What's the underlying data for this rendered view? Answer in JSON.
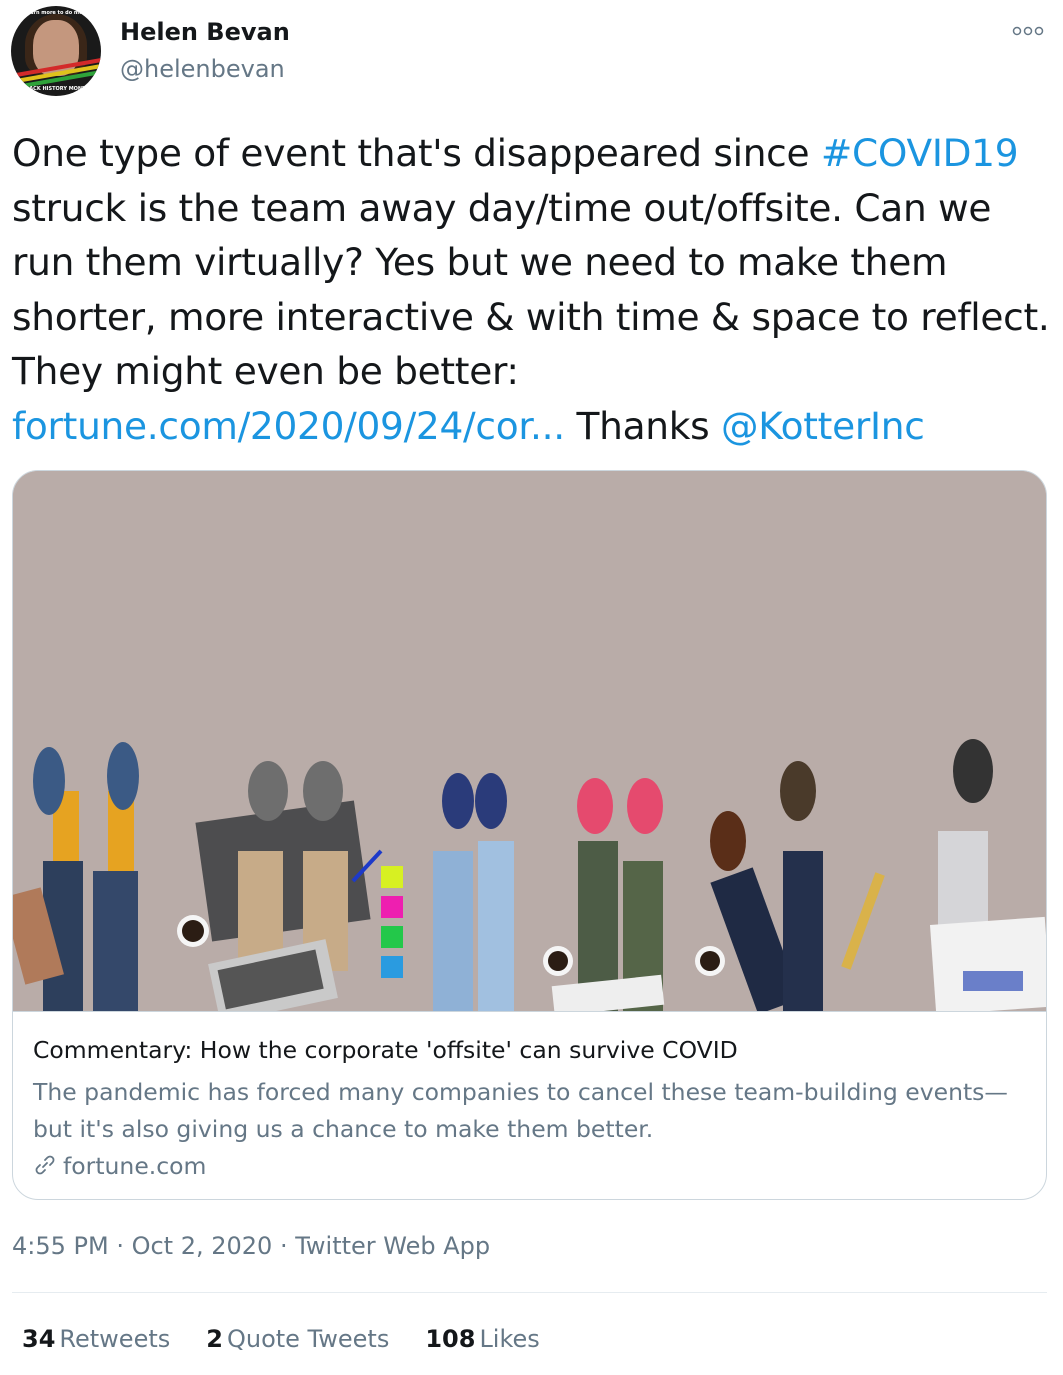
{
  "user": {
    "name": "Helen Bevan",
    "handle": "@helenbevan",
    "avatar_text_top": "Learn more to do more",
    "avatar_text_bottom": "BLACK HISTORY MONTH"
  },
  "more_icon": "more-options-icon",
  "tweet": {
    "segments": [
      {
        "text": "One type of event that's disappeared since ",
        "type": "text"
      },
      {
        "text": "#COVID19",
        "type": "hashtag"
      },
      {
        "text": " struck is the team away day/time out/offsite. Can we run them virtually? Yes but we need to make them shorter, more interactive & with time & space to reflect. They might even be better: ",
        "type": "text"
      },
      {
        "text": "fortune.com/2020/09/24/cor...",
        "type": "url"
      },
      {
        "text": " Thanks ",
        "type": "text"
      },
      {
        "text": "@KotterInc",
        "type": "mention"
      }
    ]
  },
  "card": {
    "title": "Commentary: How the corporate 'offsite' can survive COVID",
    "description": "The pandemic has forced many companies to cancel these team-building events—but it's also giving us a chance to make them better.",
    "domain": "fortune.com",
    "domain_icon": "link-icon"
  },
  "meta": {
    "time": "4:55 PM",
    "date": "Oct 2, 2020",
    "source": "Twitter Web App",
    "separator": " · "
  },
  "stats": {
    "retweets_count": "34",
    "retweets_label": "Retweets",
    "quotes_count": "2",
    "quotes_label": "Quote Tweets",
    "likes_count": "108",
    "likes_label": "Likes"
  },
  "colors": {
    "link": "#1b95e0",
    "secondary": "#657786",
    "primary": "#14171a",
    "image_bg": "#b9aca8"
  }
}
